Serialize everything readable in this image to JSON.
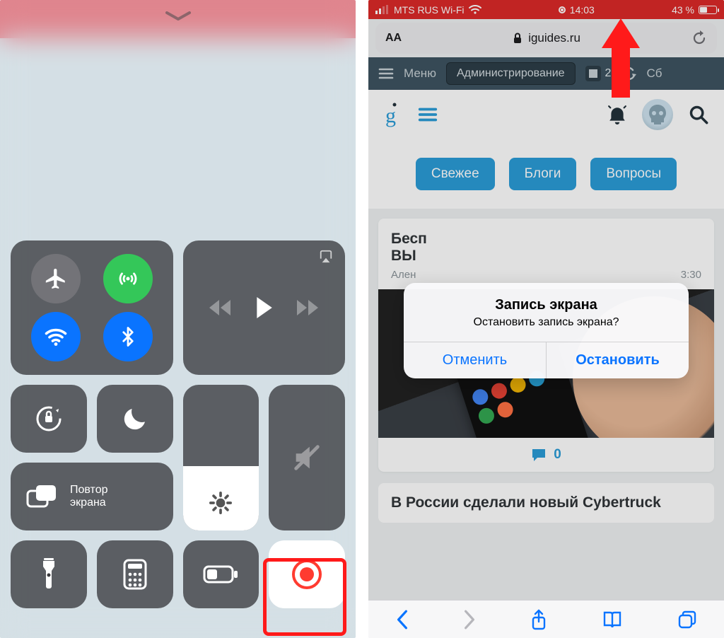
{
  "left": {
    "mirror_label": "Повтор\nэкрана"
  },
  "right": {
    "status": {
      "carrier": "MTS RUS Wi-Fi",
      "time": "14:03",
      "battery_pct": "43 %"
    },
    "url": "iguides.ru",
    "url_aa": "AA",
    "top_menu": "Меню",
    "top_admin": "Администрирование",
    "top_badge": "2",
    "top_refresh": "Сб",
    "pills": [
      "Свежее",
      "Блоги",
      "Вопросы"
    ],
    "article1_line1": "Бесп",
    "article1_line2": "ВЫ",
    "article1_author": "Ален",
    "article1_time": "3:30",
    "article1_comments": "0",
    "article2": "В России сделали новый Cybertruck",
    "alert": {
      "title": "Запись экрана",
      "message": "Остановить запись экрана?",
      "cancel": "Отменить",
      "stop": "Остановить"
    }
  }
}
